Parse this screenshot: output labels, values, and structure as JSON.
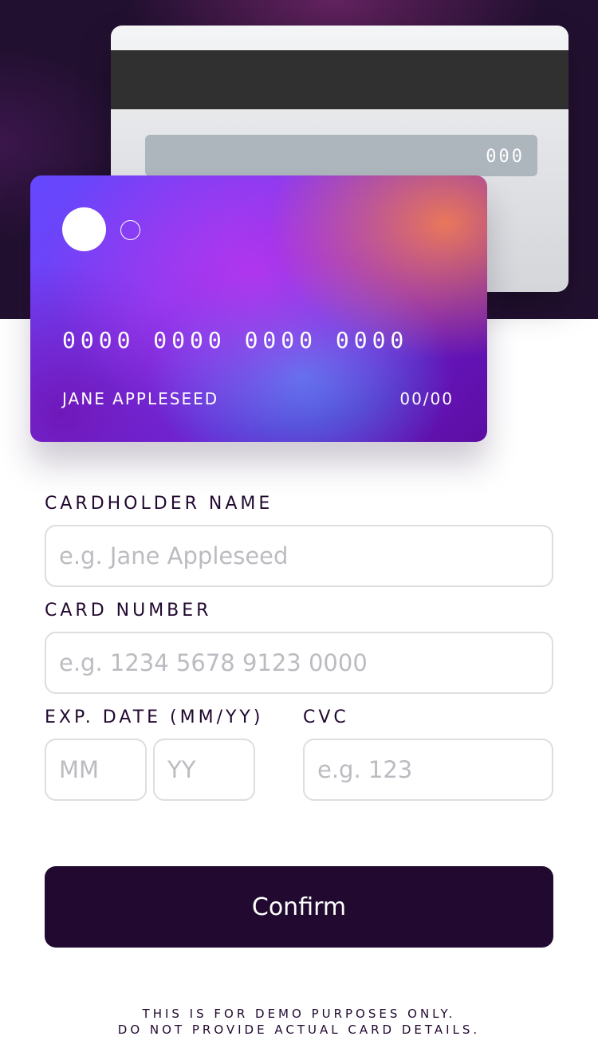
{
  "card_back": {
    "cvc": "000"
  },
  "card_front": {
    "number": "0000 0000 0000 0000",
    "name": "JANE APPLESEED",
    "expiry": "00/00"
  },
  "form": {
    "name_label": "CARDHOLDER NAME",
    "name_placeholder": "e.g. Jane Appleseed",
    "number_label": "CARD NUMBER",
    "number_placeholder": "e.g. 1234 5678 9123 0000",
    "exp_label": "EXP. DATE (MM/YY)",
    "month_placeholder": "MM",
    "year_placeholder": "YY",
    "cvc_label": "CVC",
    "cvc_placeholder": "e.g. 123",
    "confirm_label": "Confirm"
  },
  "disclaimer": {
    "line1": "THIS IS FOR DEMO PURPOSES ONLY.",
    "line2": "DO NOT PROVIDE ACTUAL CARD DETAILS."
  },
  "colors": {
    "dark_violet": "#21092f",
    "input_border": "#dedddf",
    "placeholder": "#bcbbc1",
    "card_gradient_start": "#6448fe",
    "card_gradient_end": "#600594"
  }
}
